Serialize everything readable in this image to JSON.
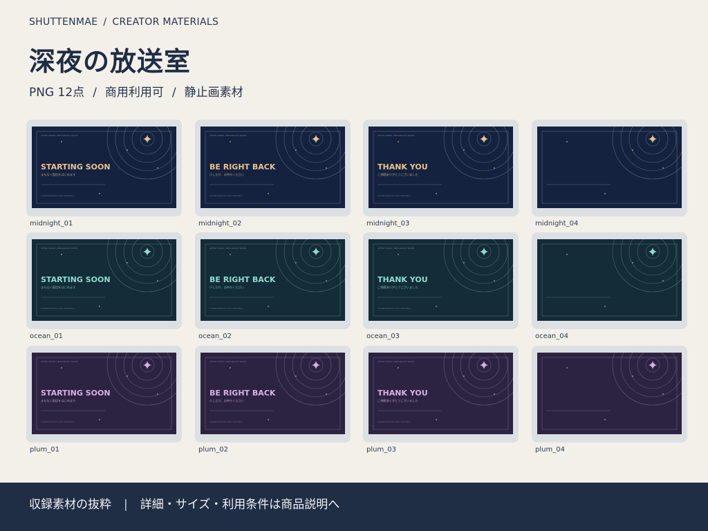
{
  "header": {
    "brand": "SHUTTENMAE",
    "breadcrumb_sep": "/",
    "section": "CREATOR MATERIALS",
    "title": "深夜の放送室",
    "subtitle_parts": [
      "PNG 12点",
      "商用利用可",
      "静止画素材"
    ],
    "subtitle_sep": "/"
  },
  "thumbnail_common": {
    "top_label": "AFTER HOURS / BROADCAST ROOM",
    "bottom_label": "a quiet place for your next story"
  },
  "themes": [
    {
      "name": "midnight",
      "bg": "#142240",
      "accent": "#e9c28c",
      "line": "#6f7b93"
    },
    {
      "name": "ocean",
      "bg": "#132c37",
      "accent": "#8fdcd0",
      "line": "#5f8088"
    },
    {
      "name": "plum",
      "bg": "#2c2342",
      "accent": "#d8b0e2",
      "line": "#7c6b8e"
    }
  ],
  "cards": [
    {
      "id": "midnight_01",
      "theme": 0,
      "title": "STARTING SOON",
      "sub": "まもなく配信をはじめます"
    },
    {
      "id": "midnight_02",
      "theme": 0,
      "title": "BE RIGHT BACK",
      "sub": "少しだけ、お待ちください"
    },
    {
      "id": "midnight_03",
      "theme": 0,
      "title": "THANK YOU",
      "sub": "ご視聴ありがとうございました"
    },
    {
      "id": "midnight_04",
      "theme": 0,
      "title": "",
      "sub": ""
    },
    {
      "id": "ocean_01",
      "theme": 1,
      "title": "STARTING SOON",
      "sub": "まもなく配信をはじめます"
    },
    {
      "id": "ocean_02",
      "theme": 1,
      "title": "BE RIGHT BACK",
      "sub": "少しだけ、お待ちください"
    },
    {
      "id": "ocean_03",
      "theme": 1,
      "title": "THANK YOU",
      "sub": "ご視聴ありがとうございました"
    },
    {
      "id": "ocean_04",
      "theme": 1,
      "title": "",
      "sub": ""
    },
    {
      "id": "plum_01",
      "theme": 2,
      "title": "STARTING SOON",
      "sub": "まもなく配信をはじめます"
    },
    {
      "id": "plum_02",
      "theme": 2,
      "title": "BE RIGHT BACK",
      "sub": "少しだけ、お待ちください"
    },
    {
      "id": "plum_03",
      "theme": 2,
      "title": "THANK YOU",
      "sub": "ご視聴ありがとうございました"
    },
    {
      "id": "plum_04",
      "theme": 2,
      "title": "",
      "sub": ""
    }
  ],
  "footer": {
    "left": "収録素材の抜粋",
    "sep": "|",
    "right": "詳細・サイズ・利用条件は商品説明へ"
  }
}
